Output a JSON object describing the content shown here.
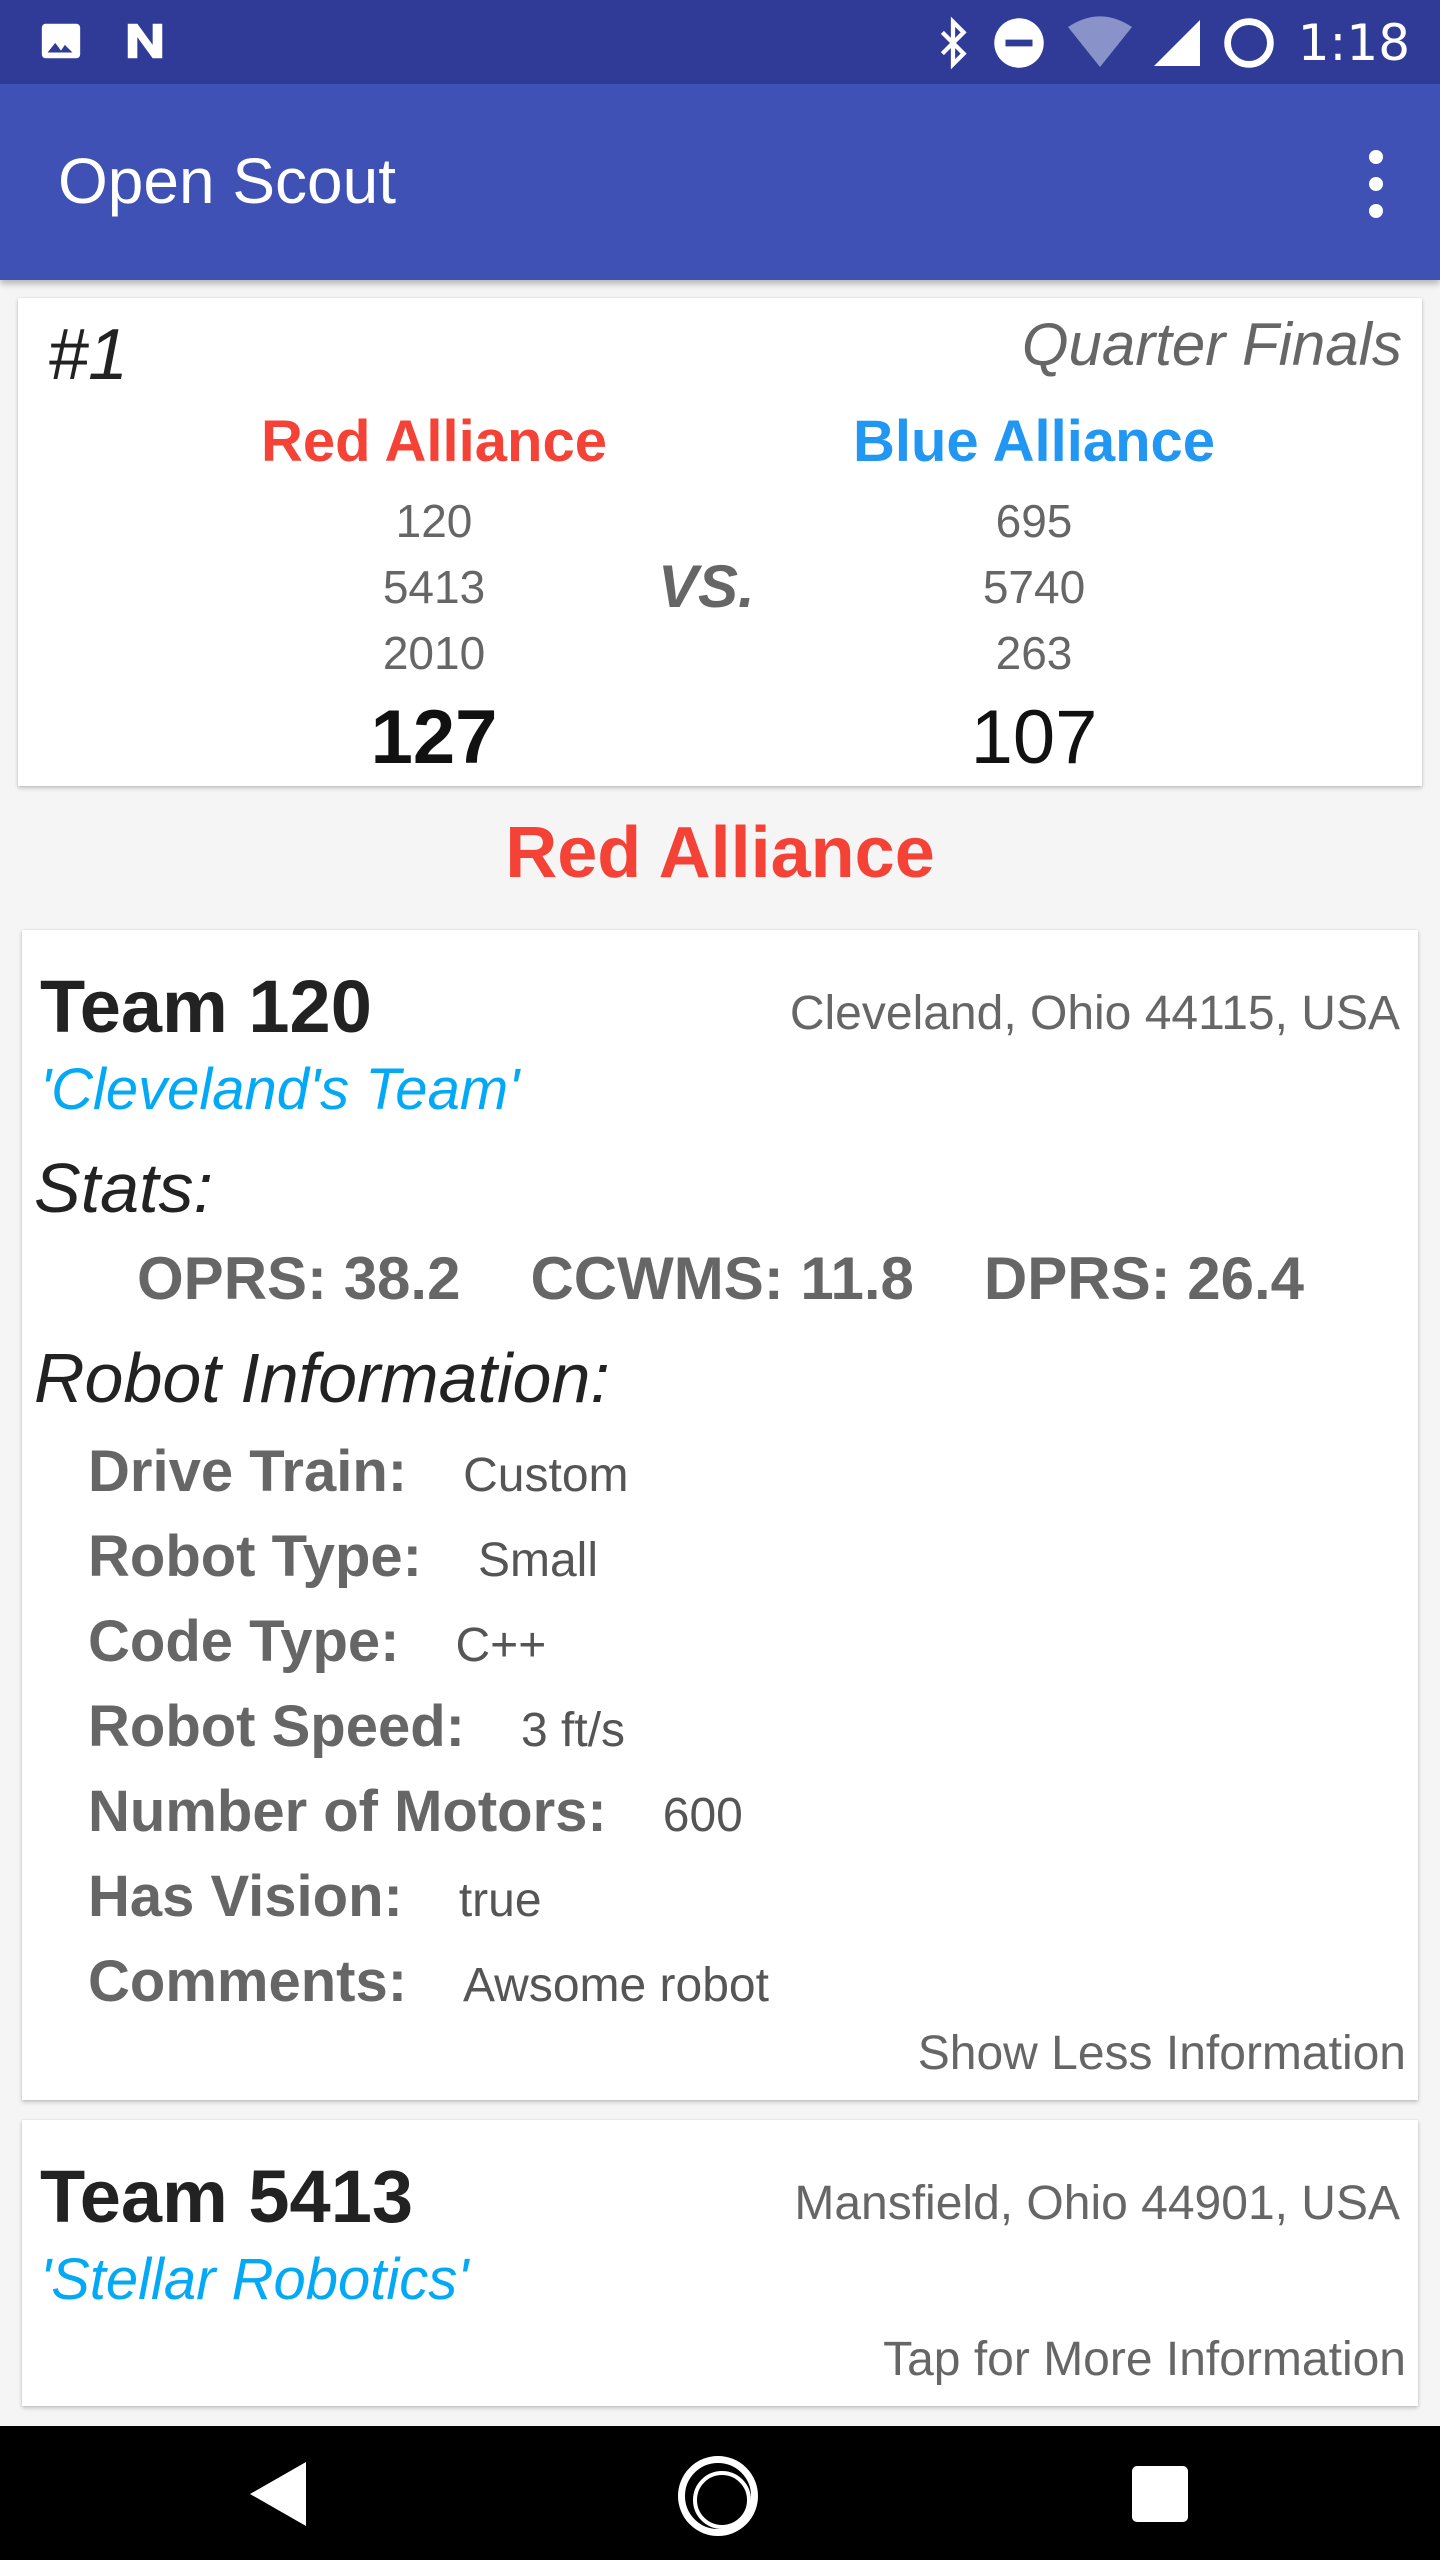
{
  "status_bar": {
    "time": "1:18",
    "icons": [
      "image-icon",
      "n-icon",
      "bluetooth-icon",
      "do-not-disturb-icon",
      "wifi-icon",
      "signal-icon",
      "battery-icon"
    ]
  },
  "app_bar": {
    "title": "Open Scout",
    "overflow_icon": "more-vert-icon"
  },
  "match": {
    "number": "#1",
    "round": "Quarter Finals",
    "vs_label": "VS.",
    "red": {
      "name": "Red Alliance",
      "teams": [
        "120",
        "5413",
        "2010"
      ],
      "score": "127",
      "color": "#f44336"
    },
    "blue": {
      "name": "Blue Alliance",
      "teams": [
        "695",
        "5740",
        "263"
      ],
      "score": "107",
      "color": "#2196f3"
    }
  },
  "section_title": "Red Alliance",
  "teams": [
    {
      "name": "Team 120",
      "location": "Cleveland, Ohio 44115, USA",
      "nickname": "'Cleveland's Team'",
      "stats_heading": "Stats:",
      "stats": [
        "OPRS: 38.2",
        "CCWMS: 11.8",
        "DPRS: 26.4"
      ],
      "robot_heading": "Robot Information:",
      "robot_info": [
        {
          "label": "Drive Train:",
          "value": "Custom"
        },
        {
          "label": "Robot Type:",
          "value": "Small"
        },
        {
          "label": "Code Type:",
          "value": "C++"
        },
        {
          "label": "Robot Speed:",
          "value": "3 ft/s"
        },
        {
          "label": "Number of Motors:",
          "value": "600"
        },
        {
          "label": "Has Vision:",
          "value": "true"
        },
        {
          "label": "Comments:",
          "value": "Awsome robot"
        }
      ],
      "link": "Show Less Information"
    },
    {
      "name": "Team 5413",
      "location": "Mansfield, Ohio 44901, USA",
      "nickname": "'Stellar Robotics'",
      "link": "Tap for More Information"
    }
  ],
  "nav_bar": {
    "back": "back-icon",
    "home": "home-icon",
    "recents": "recents-icon"
  }
}
